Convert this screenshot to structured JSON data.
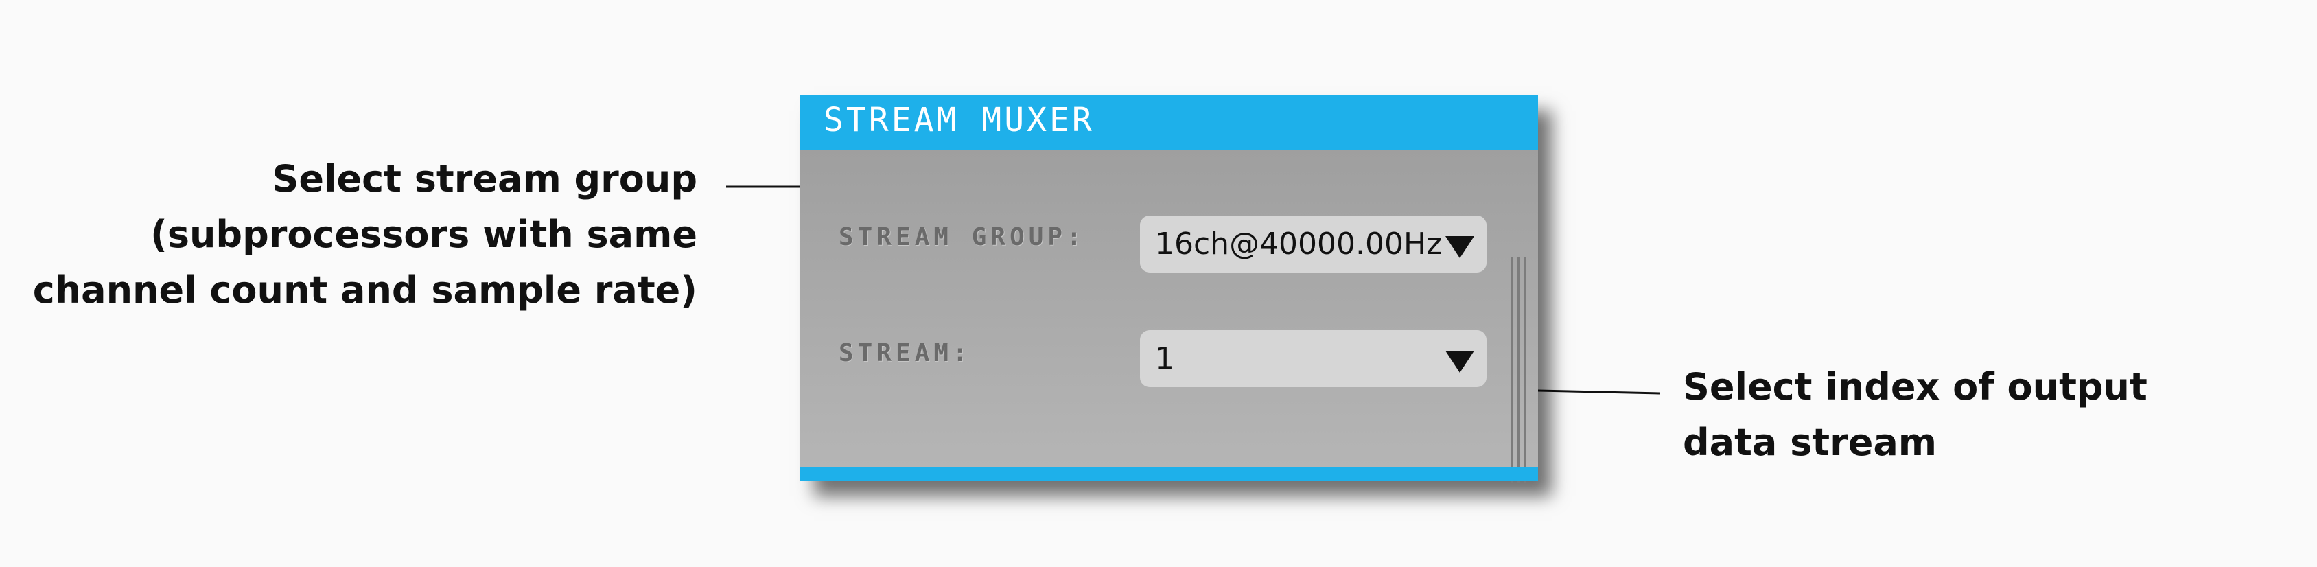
{
  "panel": {
    "title": "STREAM MUXER",
    "stream_group": {
      "label": "STREAM GROUP:",
      "value": "16ch@40000.00Hz"
    },
    "stream": {
      "label": "STREAM:",
      "value": "1"
    }
  },
  "annotations": {
    "stream_group_lines": [
      "Select stream group",
      "(subprocessors with same",
      "channel count and sample rate)"
    ],
    "stream_index_lines": [
      "Select index of output",
      "data stream"
    ]
  },
  "colors": {
    "accent": "#1eb0ea",
    "panel_body": "#a8a8a8",
    "combo_background": "#d6d6d6",
    "label_text": "#6a6a6a"
  },
  "icons": {
    "dropdown": "triangle-down-icon"
  }
}
